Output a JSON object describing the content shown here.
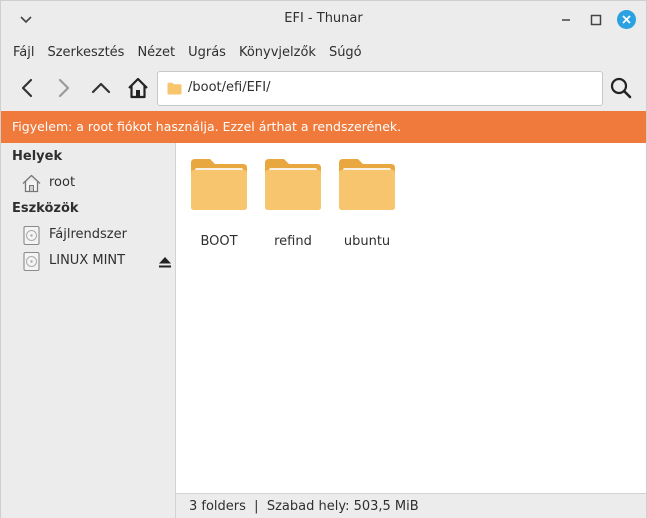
{
  "window": {
    "title": "EFI - Thunar"
  },
  "menubar": {
    "items": [
      "Fájl",
      "Szerkesztés",
      "Nézet",
      "Ugrás",
      "Könyvjelzők",
      "Súgó"
    ]
  },
  "toolbar": {
    "location": "/boot/efi/EFI/",
    "icons": [
      "back-arrow",
      "forward-arrow",
      "up-arrow",
      "home",
      "folder",
      "search"
    ]
  },
  "warning": {
    "text": "Figyelem: a root fiókot használja. Ezzel árthat a rendszerének.",
    "color": "#f07a3b"
  },
  "sidebar": {
    "places_heading": "Helyek",
    "places": [
      {
        "label": "root",
        "icon": "home-icon"
      }
    ],
    "devices_heading": "Eszközök",
    "devices": [
      {
        "label": "Fájlrendszer",
        "icon": "drive-icon"
      },
      {
        "label": "LINUX MINT",
        "icon": "drive-icon",
        "eject": true
      }
    ]
  },
  "files": [
    {
      "name": "BOOT",
      "type": "folder"
    },
    {
      "name": "refind",
      "type": "folder"
    },
    {
      "name": "ubuntu",
      "type": "folder"
    }
  ],
  "statusbar": {
    "text": "3 folders  |  Szabad hely: 503,5 MiB"
  },
  "colors": {
    "accent": "#2aa1e0",
    "folder": "#f7c56d"
  }
}
